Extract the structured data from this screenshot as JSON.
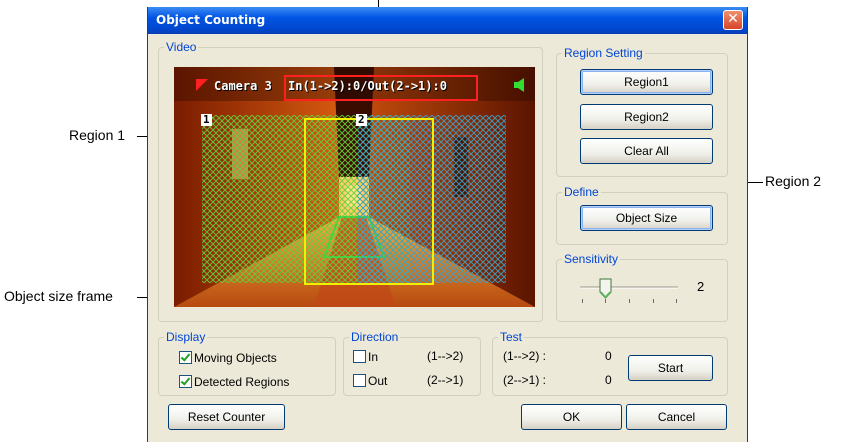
{
  "annotations": {
    "top_arrow_target": "counter-text",
    "region1": "Region 1",
    "region2": "Region 2",
    "object_size_frame": "Object size frame"
  },
  "window": {
    "title": "Object Counting",
    "close_glyph": "✕"
  },
  "video": {
    "group_label": "Video",
    "camera_label": "Camera 3",
    "counter_text": "In(1->2):0/Out(2->1):0",
    "region1_tag": "1",
    "region2_tag": "2"
  },
  "region_setting": {
    "group_label": "Region Setting",
    "region1_button": "Region1",
    "region2_button": "Region2",
    "clear_all_button": "Clear All"
  },
  "define": {
    "group_label": "Define",
    "object_size_button": "Object Size"
  },
  "sensitivity": {
    "group_label": "Sensitivity",
    "value": "2",
    "level": 2,
    "min": 1,
    "max": 5
  },
  "display": {
    "group_label": "Display",
    "moving_objects": "Moving Objects",
    "moving_objects_checked": true,
    "detected_regions": "Detected Regions",
    "detected_regions_checked": true
  },
  "direction": {
    "group_label": "Direction",
    "in_label": "In",
    "in_arrow": "(1-->2)",
    "in_checked": false,
    "out_label": "Out",
    "out_arrow": "(2-->1)",
    "out_checked": false
  },
  "test": {
    "group_label": "Test",
    "row1_label": "(1-->2) :",
    "row1_value": "0",
    "row2_label": "(2-->1) :",
    "row2_value": "0",
    "start_button": "Start"
  },
  "footer": {
    "reset_button": "Reset Counter",
    "ok_button": "OK",
    "cancel_button": "Cancel"
  },
  "colors": {
    "region1_hatch": "#5fd23c",
    "region2_hatch": "#3ca0c8",
    "frame": "#f0f000",
    "counter_box": "#ff2020",
    "legend": "#0046d5",
    "titlebar": "#0054e3"
  }
}
